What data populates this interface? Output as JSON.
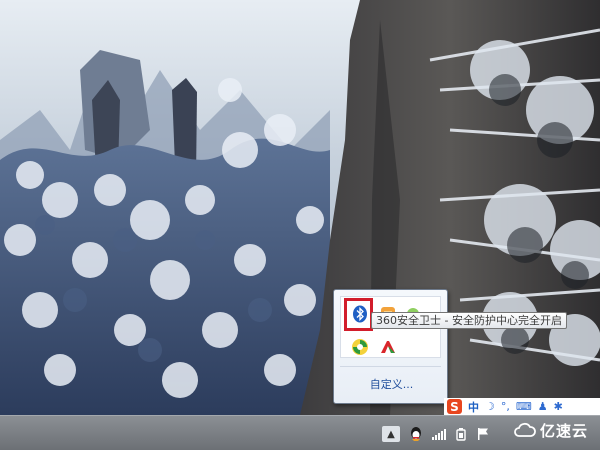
{
  "tray_popup": {
    "icons": [
      {
        "name": "bluetooth-icon",
        "color": "#1f5fc4"
      },
      {
        "name": "orange-app-icon",
        "color": "#f2a23a"
      },
      {
        "name": "green-dot-icon",
        "color": "#8fcf60"
      },
      {
        "name": "360-safeguard-icon",
        "color": "#2e9a3c"
      },
      {
        "name": "red-flag-icon",
        "color": "#d9262b"
      }
    ],
    "customize_label": "自定义..."
  },
  "tooltip": {
    "text": "360安全卫士 - 安全防护中心完全开启"
  },
  "ime_bar": {
    "logo_letter": "S",
    "lang_label": "中",
    "icons": [
      "moon-icon",
      "punctuation-icon",
      "keyboard-icon",
      "person-icon",
      "gear-icon"
    ]
  },
  "taskbar": {
    "show_hidden_glyph": "▲",
    "icons": [
      "qq-penguin-icon",
      "signal-bars-icon",
      "power-icon",
      "action-center-flag-icon"
    ]
  },
  "watermark": {
    "text": "亿速云"
  },
  "colors": {
    "highlight": "#d21d2b",
    "link": "#1f4d9c",
    "taskbar": "#7b7f84"
  }
}
